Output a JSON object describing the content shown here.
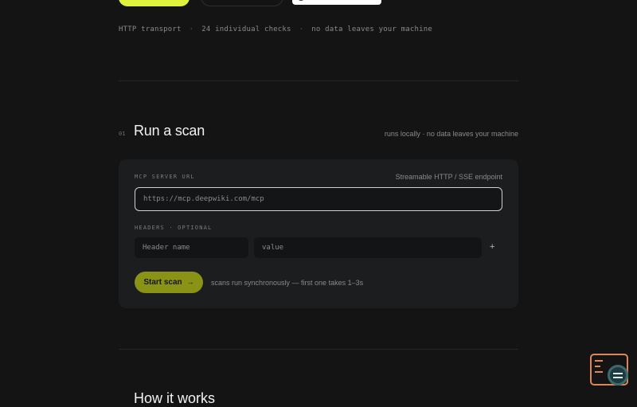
{
  "meta": {
    "items": [
      "HTTP transport",
      "24 individual checks",
      "no data leaves your machine"
    ],
    "separator": "·"
  },
  "section": {
    "number": "01",
    "title": "Run a scan",
    "note": "runs locally · no data leaves your machine"
  },
  "form": {
    "server_label": "MCP SERVER URL",
    "server_hint": "Streamable HTTP / SSE endpoint",
    "server_placeholder": "https://mcp.deepwiki.com/mcp",
    "headers_label": "HEADERS · OPTIONAL",
    "header_name_placeholder": "Header name",
    "header_value_placeholder": "value",
    "add_label": "+",
    "start_label": "Start scan",
    "start_arrow": "→",
    "scan_note": "scans run synchronously — first one takes 1–3s"
  },
  "next_section": {
    "title": "How it works"
  },
  "colors": {
    "accent": "#dff23e",
    "button": "#8a9316",
    "background": "#141414",
    "card": "#1b1d1e",
    "widget": "#e0855a"
  },
  "icons": {
    "start_arrow": "arrow-right-icon",
    "widget": "terminal-search-icon"
  }
}
